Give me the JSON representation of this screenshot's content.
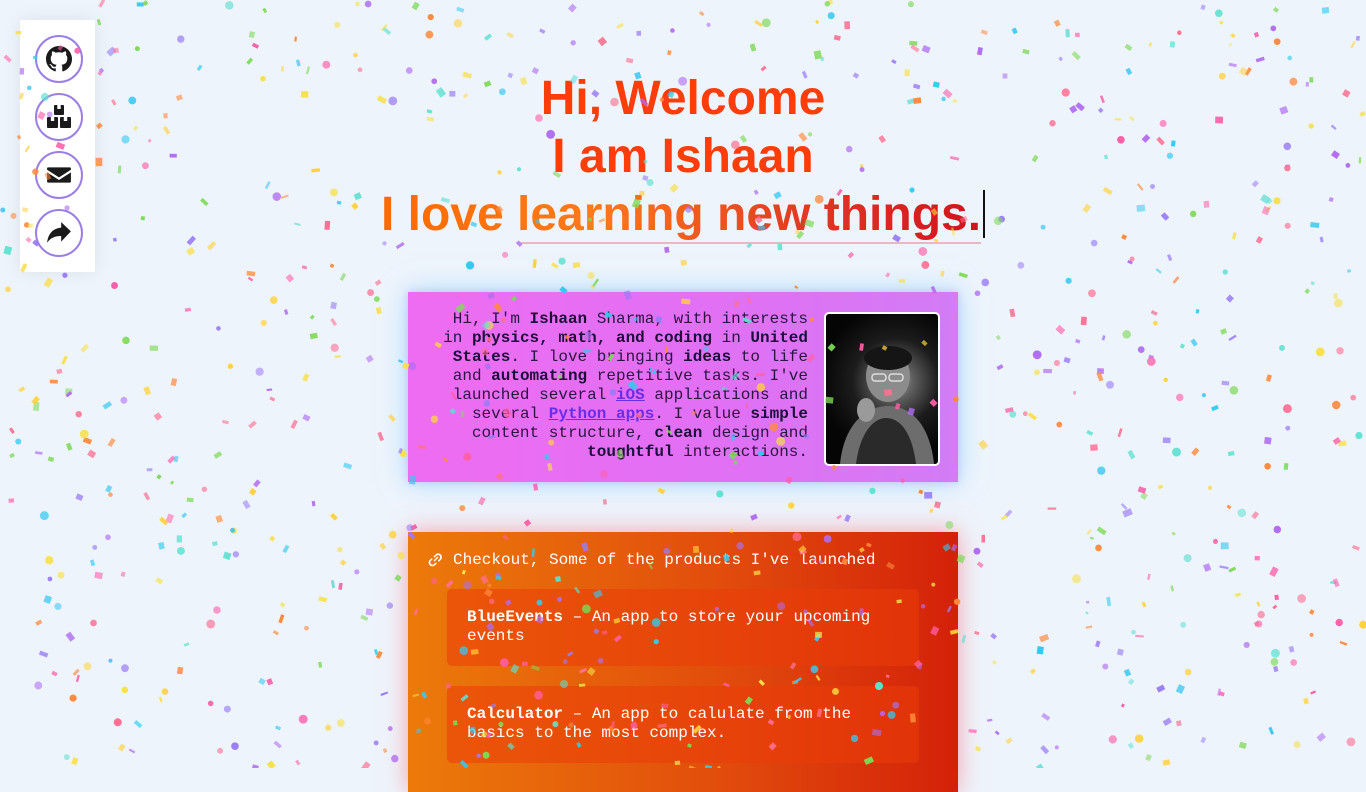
{
  "sidebar": {
    "items": [
      {
        "icon": "github-icon",
        "label": "GitHub"
      },
      {
        "icon": "boxes-icon",
        "label": "Products"
      },
      {
        "icon": "envelope-icon",
        "label": "Email"
      },
      {
        "icon": "share-icon",
        "label": "Share"
      }
    ]
  },
  "hero": {
    "line1": "Hi, Welcome",
    "line2": "I am Ishaan",
    "line3": "I love learning new things."
  },
  "about": {
    "p1": "Hi, I'm ",
    "name": "Ishaan",
    "p2": " Sharma, with interests in ",
    "interests": "physics, math, and coding",
    "p3": " in ",
    "location": "United States",
    "p4": ". I love bringing ",
    "ideas": "ideas",
    "p5": " to life and ",
    "automating": "automating",
    "p6": " repetitive tasks. I've launched several ",
    "ios_link": "iOS",
    "p7": " applications and several ",
    "python_link": "Python apps",
    "p8": ". I value ",
    "simple": "simple",
    "p9": " content structure, ",
    "clean": "clean",
    "p10": " design and ",
    "toughtful": "toughtful",
    "p11": " interactions."
  },
  "products": {
    "heading": "Checkout, Some of the products I've launched",
    "items": [
      {
        "name": "BlueEvents",
        "desc": " – An app to store your upcoming events"
      },
      {
        "name": "Calculator",
        "desc": " – An app to calulate from the basics to the most complex."
      }
    ]
  },
  "colors": {
    "accent": "#ff3d0a",
    "about_bg": "#ee6cf2",
    "products_bg": "#e24e0c",
    "link": "#6a2ee8",
    "social_ring": "#9b7fe6"
  }
}
